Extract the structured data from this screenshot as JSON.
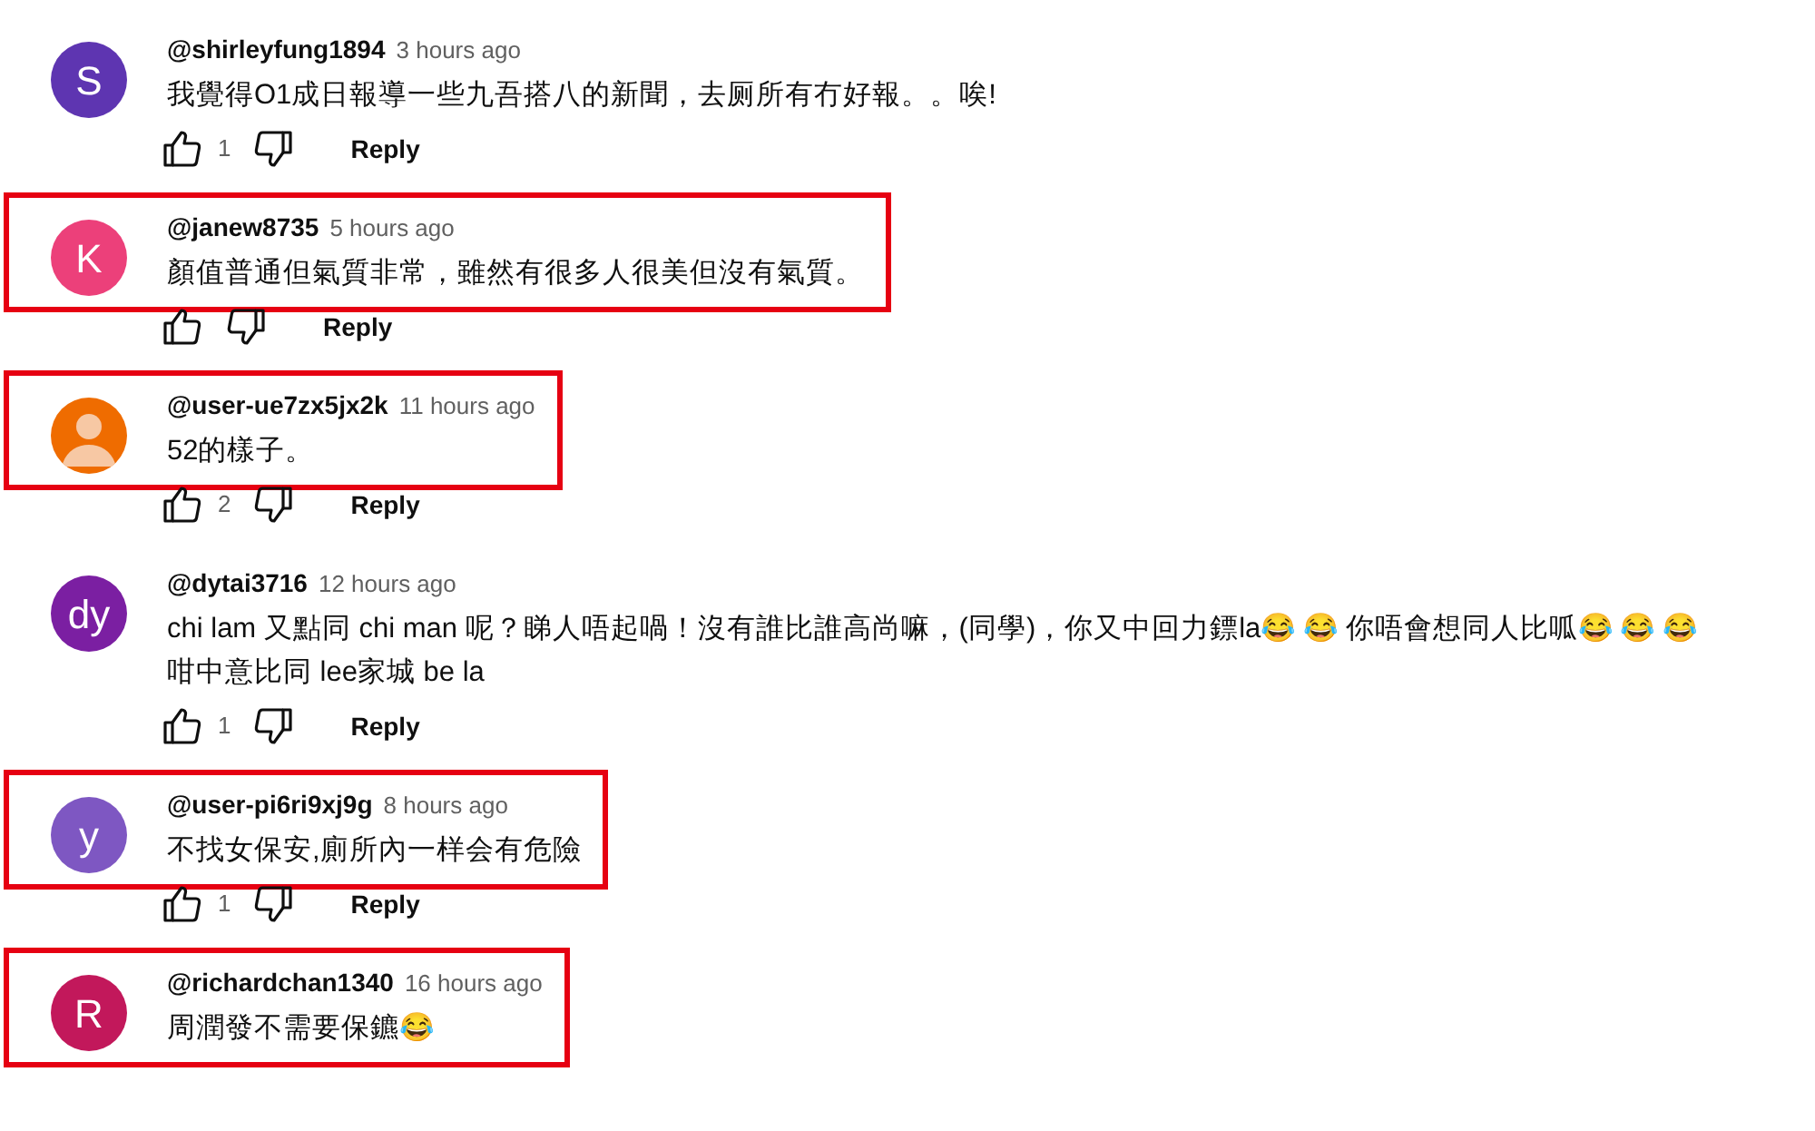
{
  "comments": [
    {
      "author": "@shirleyfung1894",
      "time": "3 hours ago",
      "avatar": {
        "kind": "letter",
        "text": "S",
        "color": "#5e35b1"
      },
      "text": "我覺得O1成日報導一些九吾搭八的新聞，去厕所有冇好報。。唉!",
      "highlighted": false,
      "actions": {
        "likes": "1",
        "reply": "Reply"
      }
    },
    {
      "author": "@janew8735",
      "time": "5 hours ago",
      "avatar": {
        "kind": "letter",
        "text": "K",
        "color": "#ec407a"
      },
      "text": "顏值普通但氣質非常，雖然有很多人很美但沒有氣質。",
      "highlighted": true,
      "actions": {
        "reply": "Reply"
      }
    },
    {
      "author": "@user-ue7zx5jx2k",
      "time": "11 hours ago",
      "avatar": {
        "kind": "silhouette",
        "color": "#ef6c00"
      },
      "text": "52的樣子。",
      "highlighted": true,
      "actions": {
        "likes": "2",
        "reply": "Reply"
      }
    },
    {
      "author": "@dytai3716",
      "time": "12 hours ago",
      "avatar": {
        "kind": "letter",
        "text": "dy",
        "color": "#7b1fa2"
      },
      "text": "chi lam 又點同 chi man 呢？睇人唔起喎！沒有誰比誰高尚嘛，(同學)，你又中回力鏢la😂 😂 你唔會想同人比呱😂 😂 😂 咁中意比同 lee家城 be la",
      "highlighted": false,
      "actions": {
        "likes": "1",
        "reply": "Reply"
      }
    },
    {
      "author": "@user-pi6ri9xj9g",
      "time": "8 hours ago",
      "avatar": {
        "kind": "letter",
        "text": "y",
        "color": "#7e57c2"
      },
      "text": "不找女保安,廁所內一样会有危險",
      "highlighted": true,
      "actions": {
        "likes": "1",
        "reply": "Reply"
      }
    },
    {
      "author": "@richardchan1340",
      "time": "16 hours ago",
      "avatar": {
        "kind": "letter",
        "text": "R",
        "color": "#c2185b"
      },
      "text": "周潤發不需要保鑣😂",
      "highlighted": true
    }
  ]
}
